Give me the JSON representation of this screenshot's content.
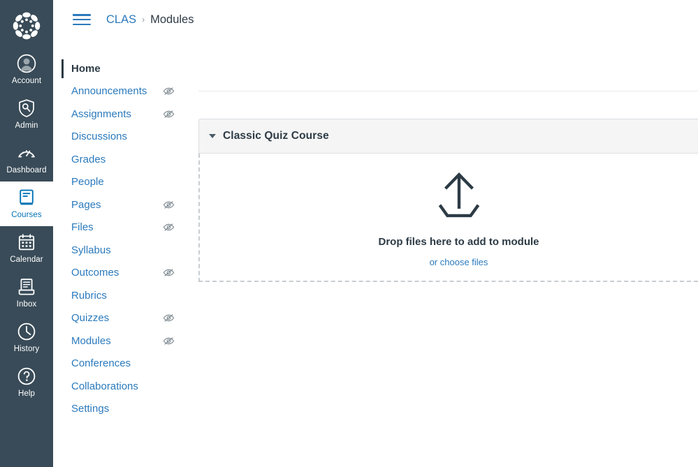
{
  "global_nav": {
    "logo_name": "canvas-logo",
    "items": [
      {
        "label": "Account",
        "icon": "user-avatar-icon",
        "active": false
      },
      {
        "label": "Admin",
        "icon": "shield-wrench-icon",
        "active": false
      },
      {
        "label": "Dashboard",
        "icon": "dashboard-gauge-icon",
        "active": false
      },
      {
        "label": "Courses",
        "icon": "book-icon",
        "active": true
      },
      {
        "label": "Calendar",
        "icon": "calendar-icon",
        "active": false
      },
      {
        "label": "Inbox",
        "icon": "inbox-tray-icon",
        "active": false
      },
      {
        "label": "History",
        "icon": "clock-icon",
        "active": false
      },
      {
        "label": "Help",
        "icon": "question-circle-icon",
        "active": false
      }
    ]
  },
  "header": {
    "menu_icon": "hamburger-menu-icon",
    "breadcrumb": {
      "course": "CLAS",
      "separator": "›",
      "current": "Modules"
    }
  },
  "course_nav": {
    "items": [
      {
        "label": "Home",
        "hidden_icon": false,
        "active": true
      },
      {
        "label": "Announcements",
        "hidden_icon": true,
        "active": false
      },
      {
        "label": "Assignments",
        "hidden_icon": true,
        "active": false
      },
      {
        "label": "Discussions",
        "hidden_icon": false,
        "active": false
      },
      {
        "label": "Grades",
        "hidden_icon": false,
        "active": false
      },
      {
        "label": "People",
        "hidden_icon": false,
        "active": false
      },
      {
        "label": "Pages",
        "hidden_icon": true,
        "active": false
      },
      {
        "label": "Files",
        "hidden_icon": true,
        "active": false
      },
      {
        "label": "Syllabus",
        "hidden_icon": false,
        "active": false
      },
      {
        "label": "Outcomes",
        "hidden_icon": true,
        "active": false
      },
      {
        "label": "Rubrics",
        "hidden_icon": false,
        "active": false
      },
      {
        "label": "Quizzes",
        "hidden_icon": true,
        "active": false
      },
      {
        "label": "Modules",
        "hidden_icon": true,
        "active": false
      },
      {
        "label": "Conferences",
        "hidden_icon": false,
        "active": false
      },
      {
        "label": "Collaborations",
        "hidden_icon": false,
        "active": false
      },
      {
        "label": "Settings",
        "hidden_icon": false,
        "active": false
      }
    ]
  },
  "main": {
    "module": {
      "title": "Classic Quiz Course",
      "collapse_icon": "caret-down-icon"
    },
    "dropzone": {
      "upload_icon": "upload-arrow-icon",
      "text": "Drop files here to add to module",
      "link": "or choose files"
    }
  },
  "colors": {
    "nav_background": "#394B58",
    "link_blue": "#2B7ABC",
    "active_blue": "#0374B5",
    "text_dark": "#2D3B45",
    "module_header_bg": "#F5F5F5",
    "dashed_border": "#C7CDD1"
  }
}
